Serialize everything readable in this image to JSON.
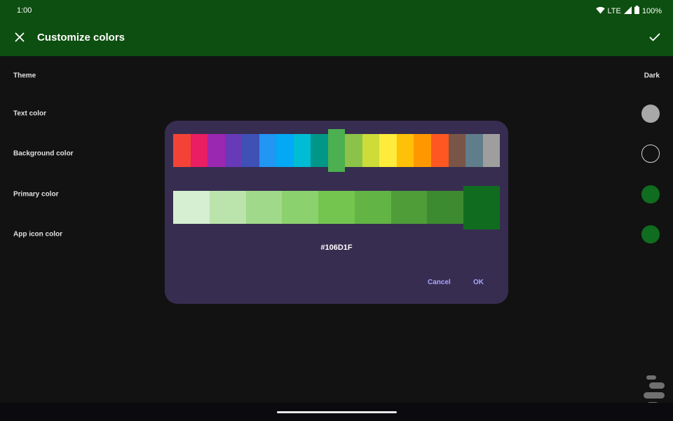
{
  "status_bar": {
    "time": "1:00",
    "network": "LTE",
    "battery": "100%"
  },
  "app_bar": {
    "title": "Customize colors",
    "close_icon": "close-icon",
    "confirm_icon": "check-icon",
    "background": "#0d4f10"
  },
  "settings": {
    "rows": [
      {
        "label": "Theme",
        "value": "Dark"
      },
      {
        "label": "Text color",
        "swatch": "#a8a8a8"
      },
      {
        "label": "Background color",
        "swatch": "#121212"
      },
      {
        "label": "Primary color",
        "swatch": "#106d1f"
      },
      {
        "label": "App icon color",
        "swatch": "#106d1f"
      }
    ]
  },
  "dialog": {
    "hue_palette": [
      "#f44336",
      "#e91e63",
      "#9c27b0",
      "#673ab7",
      "#3f51b5",
      "#2196f3",
      "#03a9f4",
      "#00bcd4",
      "#009688",
      "#4caf50",
      "#8bc34a",
      "#cddc39",
      "#ffeb3b",
      "#ffc107",
      "#ff9800",
      "#ff5722",
      "#795548",
      "#607d8b",
      "#9e9e9e"
    ],
    "hue_selected_index": 9,
    "shade_palette": [
      "#d6eed2",
      "#bbe4ad",
      "#a1d98b",
      "#8bd16e",
      "#74c54f",
      "#62b545",
      "#4e9d39",
      "#3d8b30",
      "#106d1f"
    ],
    "shade_selected_index": 8,
    "hex_value": "#106D1F",
    "cancel_label": "Cancel",
    "ok_label": "OK",
    "background": "#372d50"
  }
}
